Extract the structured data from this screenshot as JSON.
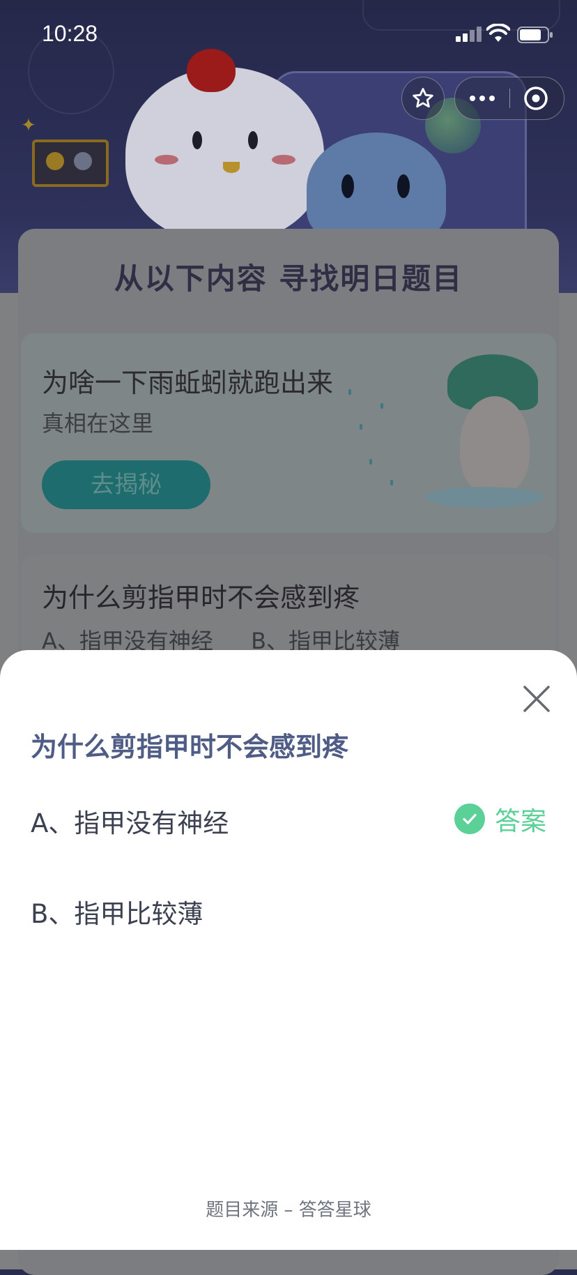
{
  "status_bar": {
    "time": "10:28"
  },
  "page": {
    "section_title": "从以下内容 寻找明日题目",
    "promo_card": {
      "title": "为啥一下雨蚯蚓就跑出来",
      "subtitle": "真相在这里",
      "button_label": "去揭秘"
    },
    "question_card": {
      "title": "为什么剪指甲时不会感到疼",
      "options": [
        "A、指甲没有神经",
        "B、指甲比较薄"
      ]
    }
  },
  "sheet": {
    "question": "为什么剪指甲时不会感到疼",
    "options": [
      {
        "label": "A、指甲没有神经",
        "is_answer": true
      },
      {
        "label": "B、指甲比较薄",
        "is_answer": false
      }
    ],
    "answer_label": "答案",
    "footer": "题目来源 – 答答星球"
  },
  "colors": {
    "accent_green": "#5bd097",
    "title_blue": "#4e5c86"
  },
  "icons": {
    "star": "star-icon",
    "more": "more-dots-icon",
    "close_miniprogram": "close-circle-icon",
    "close_sheet": "close-icon",
    "check": "check-icon"
  }
}
